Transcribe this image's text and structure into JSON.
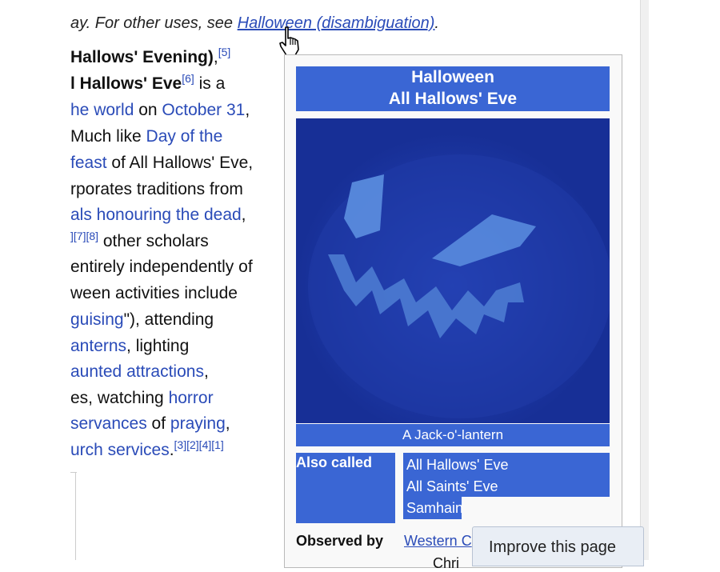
{
  "hatnote": {
    "prefix": "ay. For other uses, see ",
    "link": "Halloween (disambiguation)",
    "suffix": "."
  },
  "article": {
    "l1": {
      "text": "Hallows' Evening)",
      "end": ",",
      "ref": "[5]"
    },
    "l2": {
      "text": "l Hallows' Eve",
      "ref": "[6]",
      "rest": " is a"
    },
    "l3": {
      "link1": "he world",
      "mid": " on ",
      "link2": "October 31",
      "end": ","
    },
    "l4": {
      "text": "Much like ",
      "link": "Day of the"
    },
    "l5": {
      "link": "feast",
      "rest": " of All Hallows' Eve,"
    },
    "l6": {
      "text": "rporates traditions from"
    },
    "l7": {
      "link": "als honouring the dead",
      "end": ","
    },
    "l8": {
      "ref": "][7][8]",
      "rest": " other scholars"
    },
    "l9": {
      "text": " entirely independently of"
    },
    "l10": {
      "text": "ween activities include"
    },
    "l11": {
      "link": "guising",
      "rest": "\"), attending"
    },
    "l12": {
      "link": "anterns",
      "rest": ", lighting"
    },
    "l13": {
      "link": "aunted attractions",
      "end": ","
    },
    "l14": {
      "text": "es, watching ",
      "link": "horror"
    },
    "l15": {
      "link1": "servances",
      "mid": " of ",
      "link2": "praying",
      "end": ","
    },
    "l16": {
      "link": "urch services",
      "end": ".",
      "ref": "[3][2][4][1]"
    }
  },
  "infobox": {
    "title_line1": "Halloween",
    "title_line2": "All Hallows' Eve",
    "image_alt": "jack-o-lantern-image",
    "caption": "A Jack-o'-lantern",
    "also_called_label": "Also called",
    "also_called_values": [
      "All Hallows' Eve",
      "All Saints' Eve",
      "Samhain"
    ],
    "observed_by_label": "Observed by",
    "observed_by_value": "Western C",
    "observed_by_value2": "Chri"
  },
  "improve_button": "Improve this page",
  "colors": {
    "link": "#2a4bb8",
    "highlight": "#3a66d4",
    "image_bg": "#1d3aa8"
  }
}
